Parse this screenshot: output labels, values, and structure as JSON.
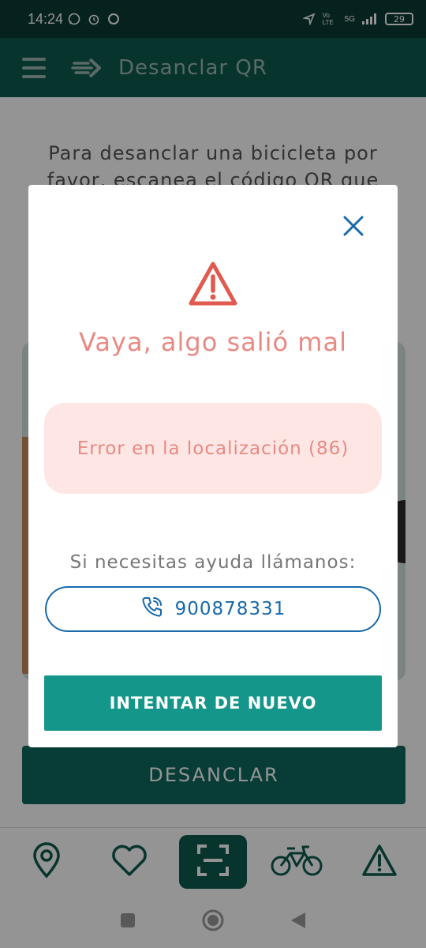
{
  "status_bar": {
    "time": "14:24",
    "network": "5G",
    "volte": "Vo LTE",
    "battery": "29"
  },
  "app_bar": {
    "title": "Desanclar QR"
  },
  "page": {
    "intro": "Para desanclar una bicicleta por favor, escanea el código QR que",
    "unlock_button": "DESANCLAR"
  },
  "dialog": {
    "title": "Vaya, algo salió mal",
    "error_message": "Error en la localización (86)",
    "help_text": "Si necesitas ayuda llámanos:",
    "phone": "900878331",
    "retry_button": "INTENTAR DE NUEVO"
  },
  "bottom_nav": {
    "items": [
      {
        "icon": "location-pin-icon",
        "active": false
      },
      {
        "icon": "heart-icon",
        "active": false
      },
      {
        "icon": "qr-scan-icon",
        "active": true
      },
      {
        "icon": "bicycle-icon",
        "active": false
      },
      {
        "icon": "warning-icon",
        "active": false
      }
    ]
  },
  "colors": {
    "primary_dark": "#0e5a50",
    "primary": "#14968a",
    "error_text": "#e88a84",
    "error_bg": "#fde6e4",
    "link_blue": "#1769aa"
  }
}
